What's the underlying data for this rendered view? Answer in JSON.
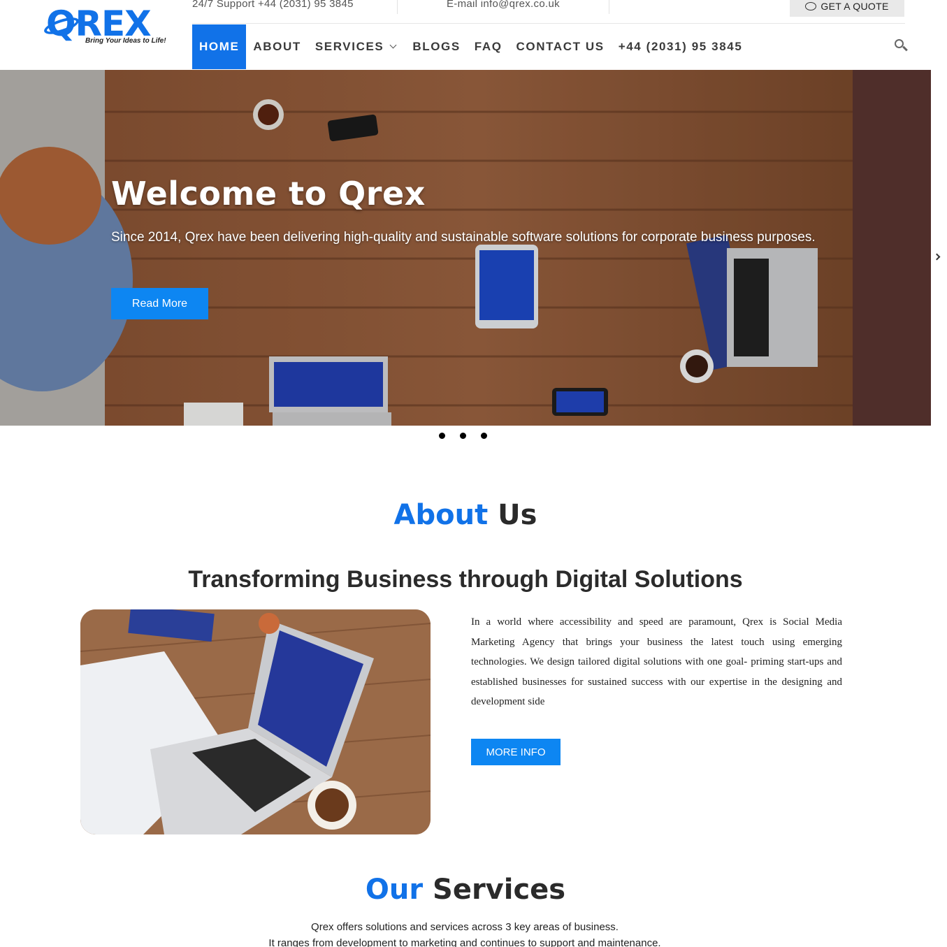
{
  "header": {
    "logo_word": "QREX",
    "logo_tagline": "Bring Your Ideas to Life!",
    "support": "24/7 Support +44 (2031) 95 3845",
    "email": "E-mail info@qrex.co.uk",
    "quote_label": "GET A QUOTE"
  },
  "nav": {
    "items": [
      {
        "label": "HOME"
      },
      {
        "label": "ABOUT"
      },
      {
        "label": "SERVICES"
      },
      {
        "label": "BLOGS"
      },
      {
        "label": "FAQ"
      },
      {
        "label": "CONTACT US"
      },
      {
        "label": "+44 (2031) 95 3845"
      }
    ],
    "active_index": 0
  },
  "hero": {
    "title": "Welcome to Qrex",
    "text": "Since 2014, Qrex have been delivering high-quality and sustainable software solutions for corporate business purposes.",
    "button": "Read More",
    "slides": 3
  },
  "about": {
    "title_accent": "About",
    "title_rest": " Us",
    "subtitle": "Transforming Business through Digital Solutions",
    "paragraph": "In a world where accessibility and speed are paramount, Qrex is Social Media Marketing Agency that brings your business the latest touch using emerging technologies. We design tailored digital solutions with one goal- priming start-ups and established businesses for sustained success with our expertise in the designing and development side",
    "button": "MORE INFO"
  },
  "services": {
    "title_accent": "Our",
    "title_rest": " Services",
    "line1": "Qrex offers solutions and services across 3 key areas of business.",
    "line2": "It ranges from development to marketing and continues to support and maintenance."
  },
  "colors": {
    "brand": "#1172e8",
    "button": "#0d86f2"
  }
}
